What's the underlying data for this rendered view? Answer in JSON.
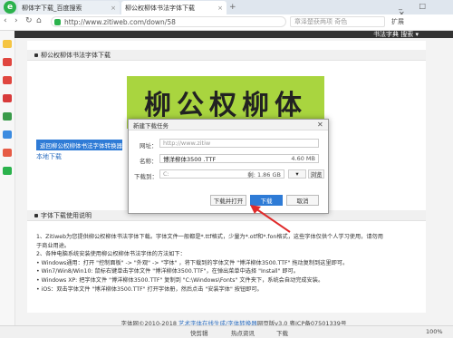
{
  "browser": {
    "tabs": [
      {
        "label": "柳体字下载_百度搜索"
      },
      {
        "label": "柳公权柳体书法字体下载"
      }
    ],
    "new_tab": "+",
    "url": "http://www.zitiweb.com/down/58",
    "search_placeholder": "章泽楚获两项 奇色",
    "ext_label": "扩展",
    "window_controls": "_ □ ✕"
  },
  "site": {
    "nav_links": "书法字典    搜索 ▾",
    "preview_title": "柳公权柳体书法字体下载",
    "preview_text": "柳公权柳体",
    "download_button": "返回柳公权柳体书法字体转换器",
    "local_download": "本地下载",
    "usage_title": "字体下载使用说明",
    "body_lines": [
      "1、Zitiweb为您提供柳公权柳体书法字体下载。字体文件一般都是*.ttf格式，少量为*.otf和*.fon格式，这些字体仅供个人学习使用，请勿用",
      "于商业用途。",
      "2、各种电脑系统安装使用柳公权柳体书法字体的方法如下：",
      "• Windows通用：打开 \"控制面板\" -> \"外观\" -> \"字体\" ，将下载到的字体文件 \"博洋柳体3500.TTF\" 拖动复制到这里即可。",
      "• Win7/Win8/Win10: 鼠标右键单击字体文件 \"博洋柳体3500.TTF\"，在弹出菜单中选择 \"Install\" 即可。",
      "• Windows XP: 把字体文件 \"博洋柳体3500.TTF\" 复制到 \"C:\\Windows\\Fonts\" 文件夹下，系统会自动完成安装。",
      "• iOS：双击字体文件 \"博洋柳体3500.TTF\" 打开字体册，然后点击 \"安装字体\" 按钮即可。"
    ],
    "footer_prefix": "字体网©2010-2018 ",
    "footer_link": "艺术字体在线生成/字体转换器",
    "footer_suffix": "网页版v3.0 粤ICP备07501339号"
  },
  "dialog": {
    "title": "新建下载任务",
    "url_label": "网址：",
    "url_value": "http://www.zitiw",
    "name_label": "名称：",
    "name_value": "博洋柳体3500 .TTF",
    "size": "4.60 MB",
    "dest_label": "下载到：",
    "dest_value": "C:",
    "free_space": "剩: 1.86 GB",
    "browse": "浏览",
    "open_after": "下载并打开",
    "download": "下载",
    "cancel": "取消"
  },
  "status": {
    "items": [
      "快剪辑",
      "热点资讯",
      "下载"
    ],
    "zoom": "100%"
  },
  "colors": {
    "accent": "#2e7bd6",
    "brand_green": "#2bb24c",
    "preview_bg": "#a9d53f"
  }
}
